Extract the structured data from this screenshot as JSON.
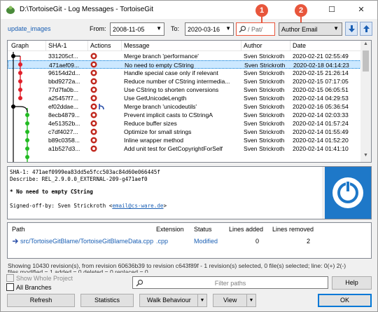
{
  "window": {
    "title": "D:\\TortoiseGit - Log Messages - TortoiseGit"
  },
  "callouts": [
    "1",
    "2"
  ],
  "toolbar": {
    "branch_link": "update_images",
    "from_label": "From:",
    "from_date": "2008-11-05",
    "to_label": "To:",
    "to_date": "2020-03-16",
    "search_placeholder": "/ Pat/",
    "filter_field": "Author Email"
  },
  "log": {
    "columns": [
      "Graph",
      "SHA-1",
      "Actions",
      "Message",
      "Author",
      "Date"
    ],
    "rows": [
      {
        "sha": "331205cf...",
        "message": "Merge branch 'performance'",
        "author": "Sven Strickroth",
        "date": "2020-02-21 02:55:49",
        "selected": false
      },
      {
        "sha": "471aef09...",
        "message": "No need to empty CString",
        "author": "Sven Strickroth",
        "date": "2020-02-18 04:14:23",
        "selected": true
      },
      {
        "sha": "96154d2d...",
        "message": "Handle special case only if relevant",
        "author": "Sven Strickroth",
        "date": "2020-02-15 21:26:14",
        "selected": false
      },
      {
        "sha": "bbd9272a...",
        "message": "Reduce number of CString intermedia...",
        "author": "Sven Strickroth",
        "date": "2020-02-15 07:17:05",
        "selected": false
      },
      {
        "sha": "77d7fa0b...",
        "message": "Use CString to shorten conversions",
        "author": "Sven Strickroth",
        "date": "2020-02-15 06:05:51",
        "selected": false
      },
      {
        "sha": "a25457f7...",
        "message": "Use GetUnicodeLength",
        "author": "Sven Strickroth",
        "date": "2020-02-14 04:29:53",
        "selected": false
      },
      {
        "sha": "ef02ddae...",
        "message": "Merge branch 'unicodeutils'",
        "author": "Sven Strickroth",
        "date": "2020-02-16 05:36:54",
        "selected": false
      },
      {
        "sha": "8ecb4879...",
        "message": "Prevent implicit casts to CStringA",
        "author": "Sven Strickroth",
        "date": "2020-02-14 02:03:33",
        "selected": false
      },
      {
        "sha": "4e51352b...",
        "message": "Reduce buffer sizes",
        "author": "Sven Strickroth",
        "date": "2020-02-14 01:57:24",
        "selected": false
      },
      {
        "sha": "c7df4027...",
        "message": "Optimize for small strings",
        "author": "Sven Strickroth",
        "date": "2020-02-14 01:55:49",
        "selected": false
      },
      {
        "sha": "b89c0358...",
        "message": "Inline wrapper method",
        "author": "Sven Strickroth",
        "date": "2020-02-14 01:52:20",
        "selected": false
      },
      {
        "sha": "a1b527d3...",
        "message": "Add unit test for GetCopyrightForSelf",
        "author": "Sven Strickroth",
        "date": "2020-02-14 01:41:10",
        "selected": false
      }
    ]
  },
  "detail": {
    "sha_line": "SHA-1: 471aef0999ea83dd5e5fcc503ac84d60e066445f",
    "describe_line": "Describe: REL_2.9.0.0_EXTERNAL-209-g471aef0",
    "subject_line": "* No need to empty CString",
    "signed_prefix": "Signed-off-by: Sven Strickroth <",
    "signed_email": "email@cs-ware.de",
    "signed_suffix": ">"
  },
  "files": {
    "columns": [
      "Path",
      "Extension",
      "Status",
      "Lines added",
      "Lines removed"
    ],
    "rows": [
      {
        "path": "src/TortoiseGitBlame/TortoiseGitBlameData.cpp",
        "extension": ".cpp",
        "status": "Modified",
        "added": "0",
        "removed": "2"
      }
    ]
  },
  "status": {
    "line1": "Showing 10430 revision(s), from revision 60636b39 to revision c643f89f - 1 revision(s) selected, 0 file(s) selected; line: 0(+) 2(-)",
    "line2": "files modified = 1 added = 0 deleted = 0 replaced = 0"
  },
  "bottom": {
    "show_whole_project": "Show Whole Project",
    "all_branches": "All Branches",
    "filter_placeholder": "Filter paths",
    "help": "Help",
    "refresh": "Refresh",
    "statistics": "Statistics",
    "walk_behaviour": "Walk Behaviour",
    "view": "View",
    "ok": "OK"
  },
  "colors": {
    "accent": "#1a5fb4",
    "selection": "#cce8ff",
    "callout": "#e8563c",
    "graph_red": "#e0202a",
    "graph_green": "#22bb22",
    "logo_blue": "#1e78c8"
  }
}
